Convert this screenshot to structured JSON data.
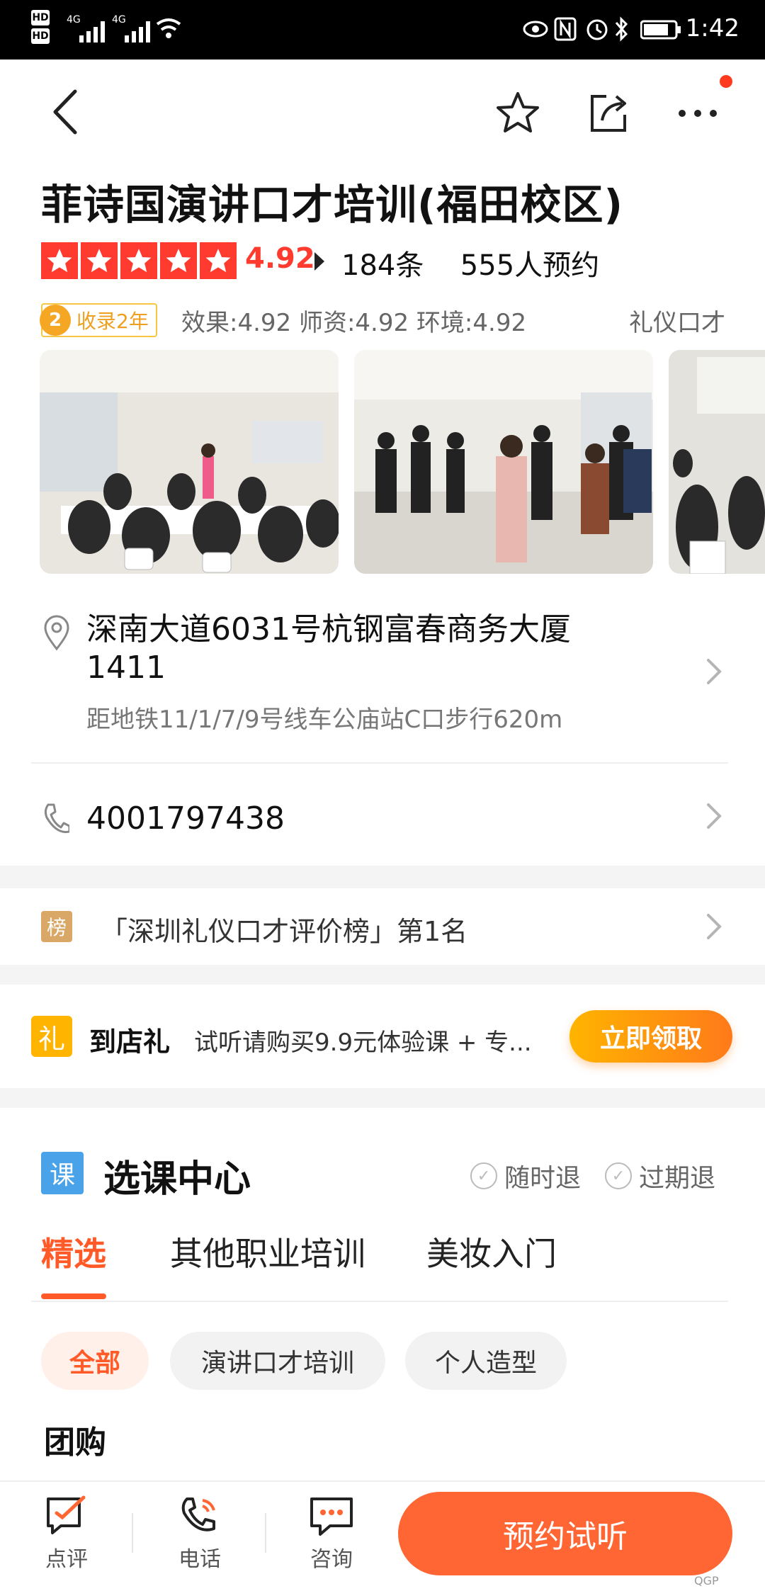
{
  "status_bar": {
    "time": "1:42",
    "network_1": "4G",
    "network_2": "4G"
  },
  "shop": {
    "title": "菲诗国演讲口才培训(福田校区)",
    "score": "4.92",
    "reviews": "184条",
    "bookings": "555人预约",
    "badge_num": "2",
    "badge_text": "收录2年",
    "subscores": "效果:4.92 师资:4.92 环境:4.92",
    "category": "礼仪口才"
  },
  "address": {
    "line1": "深南大道6031号杭钢富春商务大厦",
    "line2": "1411",
    "metro": "距地铁11/1/7/9号线车公庙站C口步行620m"
  },
  "phone": "4001797438",
  "rank": {
    "tag": "榜",
    "text": "「深圳礼仪口才评价榜」第1名"
  },
  "gift": {
    "tag": "礼",
    "title": "到店礼",
    "desc": "试听请购买9.9元体验课 + 专...",
    "button": "立即领取"
  },
  "courses": {
    "tag": "课",
    "title": "选课中心",
    "guarantee_1": "随时退",
    "guarantee_2": "过期退",
    "tabs": [
      "精选",
      "其他职业培训",
      "美妆入门"
    ],
    "chips": [
      "全部",
      "演讲口才培训",
      "个人造型"
    ],
    "group_heading": "团购"
  },
  "bottom_bar": {
    "review": "点评",
    "call": "电话",
    "consult": "咨询",
    "book": "预约试听",
    "watermark": "QGP"
  }
}
